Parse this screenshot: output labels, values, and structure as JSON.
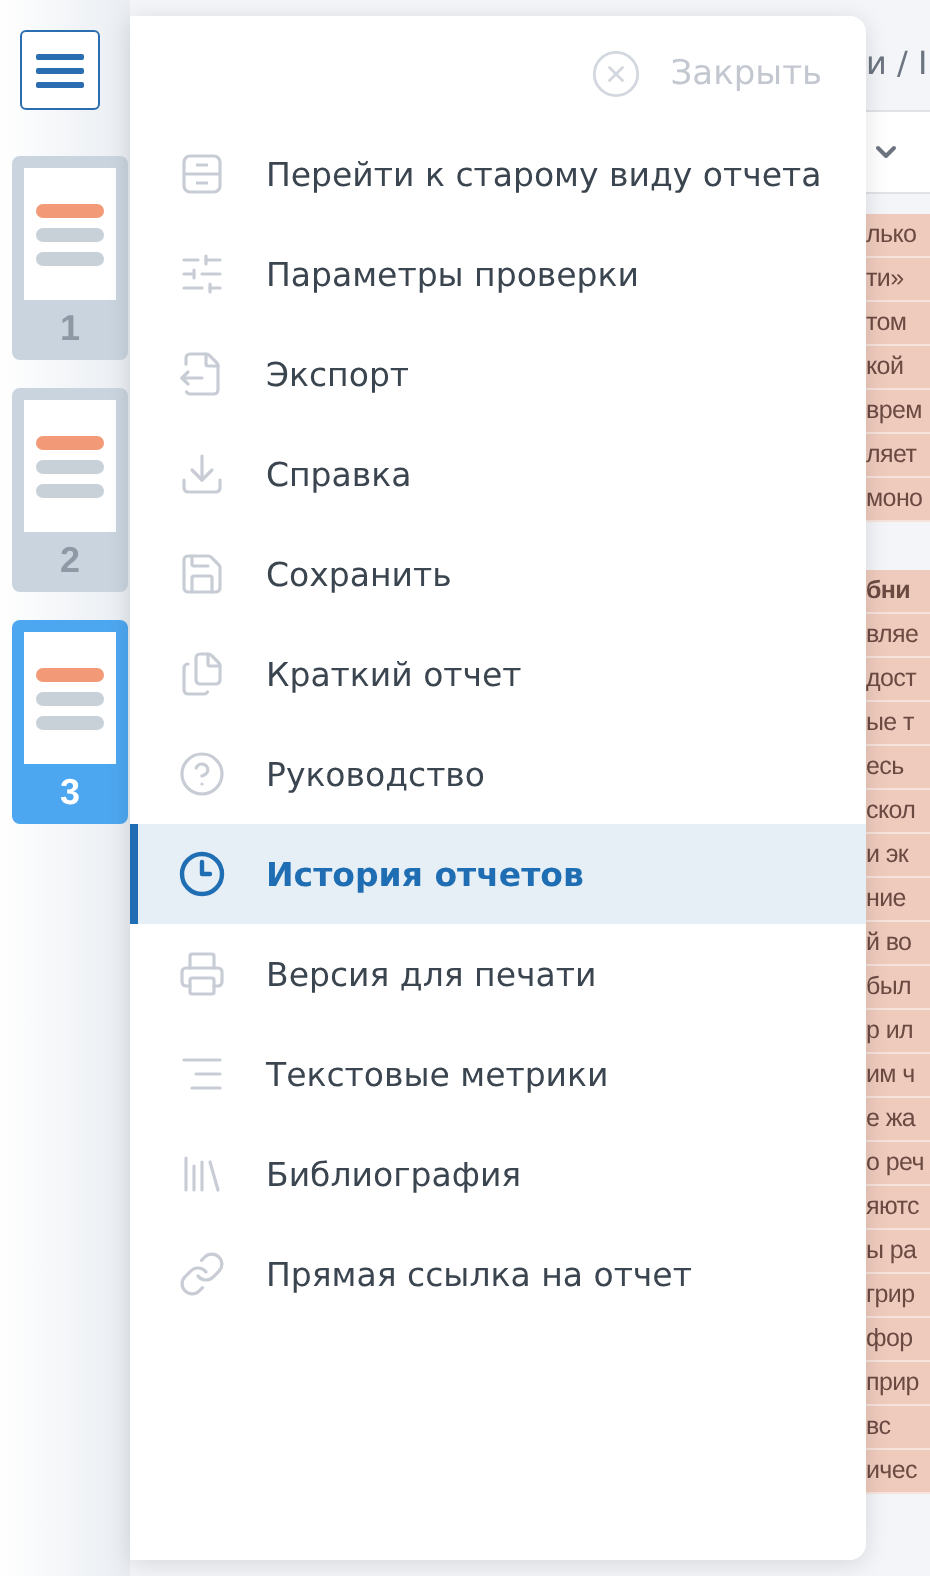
{
  "pages": [
    {
      "label": "1",
      "selected": false
    },
    {
      "label": "2",
      "selected": false
    },
    {
      "label": "3",
      "selected": true
    }
  ],
  "menu": {
    "close_label": "Закрыть",
    "items": [
      {
        "label": "Перейти к старому виду отчета",
        "selected": false
      },
      {
        "label": "Параметры проверки",
        "selected": false
      },
      {
        "label": "Экспорт",
        "selected": false
      },
      {
        "label": "Справка",
        "selected": false
      },
      {
        "label": "Сохранить",
        "selected": false
      },
      {
        "label": "Краткий отчет",
        "selected": false
      },
      {
        "label": "Руководство",
        "selected": false
      },
      {
        "label": "История отчетов",
        "selected": true
      },
      {
        "label": "Версия для печати",
        "selected": false
      },
      {
        "label": "Текстовые метрики",
        "selected": false
      },
      {
        "label": "Библиография",
        "selected": false
      },
      {
        "label": "Прямая ссылка на отчет",
        "selected": false
      }
    ]
  },
  "background": {
    "breadcrumb": "и / I",
    "blocks": [
      {
        "lines": [
          "лько",
          "ти»",
          "том",
          "кой",
          "врем",
          "ляет",
          "моно"
        ]
      },
      {
        "heading": "бни",
        "lines": [
          "вляе",
          "дост",
          "ые т",
          "есь",
          "скол",
          "и эк",
          "ние",
          "й во",
          "был",
          "р ил",
          "им ч",
          "е жа",
          "о реч",
          "яютс",
          "ы ра",
          "грир",
          "фор",
          "прир",
          "вс",
          "ичес"
        ]
      }
    ]
  }
}
